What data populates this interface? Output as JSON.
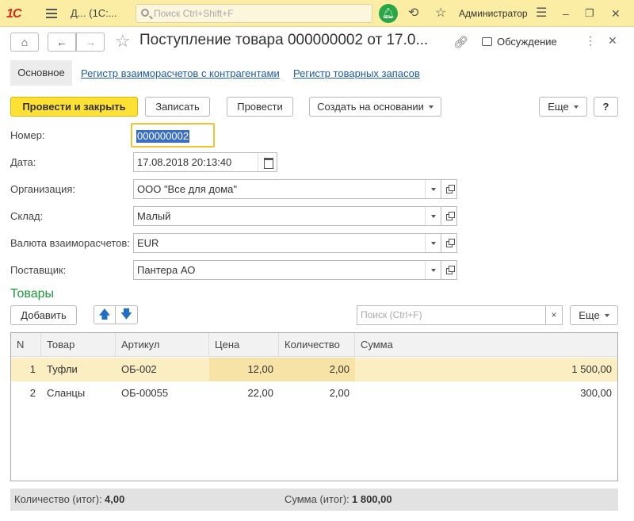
{
  "topbar": {
    "logo": "1С",
    "app_title": "Д...  (1С:...",
    "search_placeholder": "Поиск Ctrl+Shift+F",
    "user": "Администратор"
  },
  "form": {
    "title": "Поступление товара 000000002 от 17.0...",
    "discuss_label": "Обсуждение"
  },
  "tabs": {
    "main": "Основное",
    "links": [
      "Регистр взаиморасчетов с контрагентами",
      "Регистр товарных запасов"
    ]
  },
  "toolbar": {
    "post_close": "Провести и закрыть",
    "write": "Записать",
    "post": "Провести",
    "create_based": "Создать на основании",
    "more": "Еще",
    "help": "?"
  },
  "fields": {
    "number": {
      "label": "Номер:",
      "value": "000000002"
    },
    "date": {
      "label": "Дата:",
      "value": "17.08.2018 20:13:40"
    },
    "organization": {
      "label": "Организация:",
      "value": "ООО \"Все для дома\""
    },
    "warehouse": {
      "label": "Склад:",
      "value": "Малый"
    },
    "currency": {
      "label": "Валюта взаиморасчетов:",
      "value": "EUR"
    },
    "supplier": {
      "label": "Поставщик:",
      "value": "Пантера АО"
    }
  },
  "goods": {
    "section_title": "Товары",
    "add_label": "Добавить",
    "search_placeholder": "Поиск (Ctrl+F)",
    "more": "Еще",
    "columns": [
      "N",
      "Товар",
      "Артикул",
      "Цена",
      "Количество",
      "Сумма"
    ],
    "rows": [
      {
        "n": "1",
        "product": "Туфли",
        "article": "ОБ-002",
        "price": "12,00",
        "qty": "2,00",
        "sum": "1 500,00",
        "selected": true
      },
      {
        "n": "2",
        "product": "Сланцы",
        "article": "ОБ-00055",
        "price": "22,00",
        "qty": "2,00",
        "sum": "300,00",
        "selected": false
      }
    ]
  },
  "totals": {
    "qty_label": "Количество (итог):",
    "qty_value": "4,00",
    "sum_label": "Сумма (итог):",
    "sum_value": "1 800,00"
  },
  "colors": {
    "accent_yellow": "#ffe034",
    "topbar": "#fbeda4",
    "link": "#1f5da5",
    "section_green": "#1b9a3a",
    "selected_row": "#fbeec2"
  }
}
